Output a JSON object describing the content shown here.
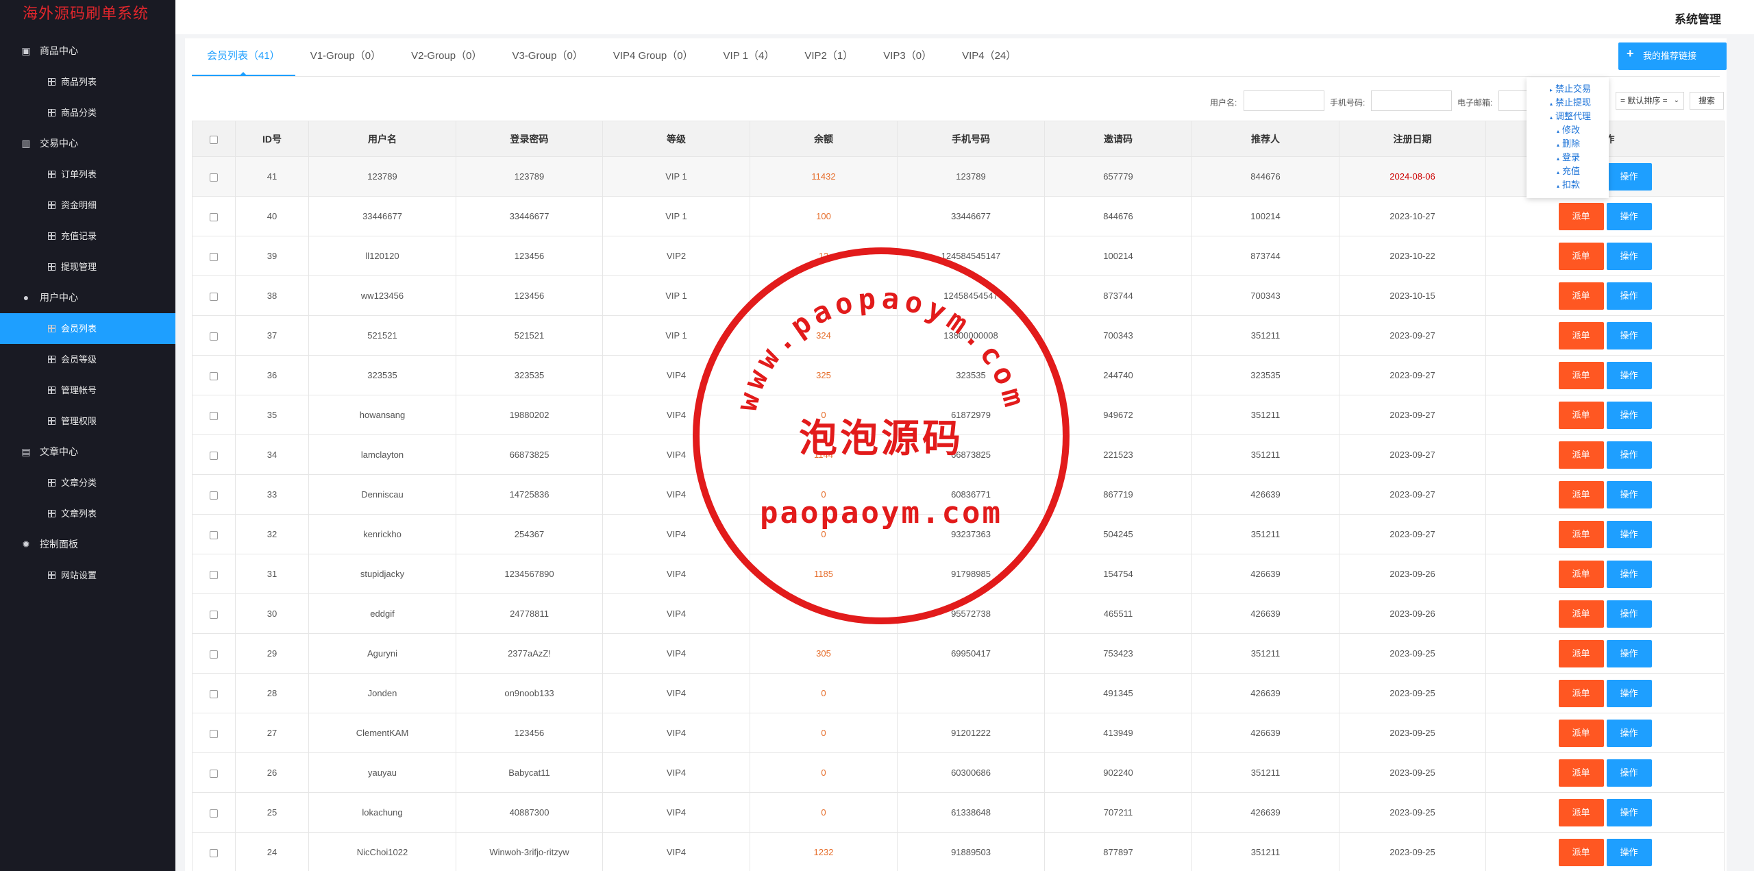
{
  "brand": "海外源码刷单系统",
  "header": {
    "title": "系统管理"
  },
  "sidebar": {
    "groups": [
      {
        "label": "商品中心",
        "icon": "product-icon",
        "items": [
          {
            "label": "商品列表"
          },
          {
            "label": "商品分类"
          }
        ]
      },
      {
        "label": "交易中心",
        "icon": "chart-icon",
        "items": [
          {
            "label": "订单列表"
          },
          {
            "label": "资金明细"
          },
          {
            "label": "充值记录"
          },
          {
            "label": "提现管理"
          }
        ]
      },
      {
        "label": "用户中心",
        "icon": "user-icon",
        "items": [
          {
            "label": "会员列表"
          },
          {
            "label": "会员等级"
          },
          {
            "label": "管理帐号"
          },
          {
            "label": "管理权限"
          }
        ]
      },
      {
        "label": "文章中心",
        "icon": "document-icon",
        "items": [
          {
            "label": "文章分类"
          },
          {
            "label": "文章列表"
          }
        ]
      },
      {
        "label": "控制面板",
        "icon": "gear-icon",
        "items": [
          {
            "label": "网站设置"
          }
        ]
      }
    ],
    "active_item": "会员列表"
  },
  "tabs": [
    {
      "label": "会员列表（41）"
    },
    {
      "label": "V1-Group（0）"
    },
    {
      "label": "V2-Group（0）"
    },
    {
      "label": "V3-Group（0）"
    },
    {
      "label": "VIP4 Group（0）"
    },
    {
      "label": "VIP 1（4）"
    },
    {
      "label": "VIP2（1）"
    },
    {
      "label": "VIP3（0）"
    },
    {
      "label": "VIP4（24）"
    }
  ],
  "recommend_button": "我的推荐链接",
  "search": {
    "username_label": "用户名:",
    "phone_label": "手机号码:",
    "email_label": "电子邮箱:",
    "sort_value": "= 默认排序 =",
    "search_button": "搜索"
  },
  "table": {
    "headers": [
      "ID号",
      "用户名",
      "登录密码",
      "等级",
      "余额",
      "手机号码",
      "邀请码",
      "推荐人",
      "注册日期",
      "操作"
    ],
    "rows": [
      {
        "id": "41",
        "user": "123789",
        "pwd": "123789",
        "level": "VIP 1",
        "balance": "11432",
        "phone": "123789",
        "invite": "657779",
        "ref": "844676",
        "date": "2024-08-06"
      },
      {
        "id": "40",
        "user": "33446677",
        "pwd": "33446677",
        "level": "VIP 1",
        "balance": "100",
        "phone": "33446677",
        "invite": "844676",
        "ref": "100214",
        "date": "2023-10-27"
      },
      {
        "id": "39",
        "user": "ll120120",
        "pwd": "123456",
        "level": "VIP2",
        "balance": "13",
        "phone": "124584545147",
        "invite": "100214",
        "ref": "873744",
        "date": "2023-10-22"
      },
      {
        "id": "38",
        "user": "ww123456",
        "pwd": "123456",
        "level": "VIP 1",
        "balance": "",
        "phone": "12458454547",
        "invite": "873744",
        "ref": "700343",
        "date": "2023-10-15"
      },
      {
        "id": "37",
        "user": "521521",
        "pwd": "521521",
        "level": "VIP 1",
        "balance": "324",
        "phone": "13800000008",
        "invite": "700343",
        "ref": "351211",
        "date": "2023-09-27"
      },
      {
        "id": "36",
        "user": "323535",
        "pwd": "323535",
        "level": "VIP4",
        "balance": "325",
        "phone": "323535",
        "invite": "244740",
        "ref": "323535",
        "date": "2023-09-27"
      },
      {
        "id": "35",
        "user": "howansang",
        "pwd": "19880202",
        "level": "VIP4",
        "balance": "0",
        "phone": "61872979",
        "invite": "949672",
        "ref": "351211",
        "date": "2023-09-27"
      },
      {
        "id": "34",
        "user": "lamclayton",
        "pwd": "66873825",
        "level": "VIP4",
        "balance": "1144",
        "phone": "66873825",
        "invite": "221523",
        "ref": "351211",
        "date": "2023-09-27"
      },
      {
        "id": "33",
        "user": "Denniscau",
        "pwd": "14725836",
        "level": "VIP4",
        "balance": "0",
        "phone": "60836771",
        "invite": "867719",
        "ref": "426639",
        "date": "2023-09-27"
      },
      {
        "id": "32",
        "user": "kenrickho",
        "pwd": "254367",
        "level": "VIP4",
        "balance": "0",
        "phone": "93237363",
        "invite": "504245",
        "ref": "351211",
        "date": "2023-09-27"
      },
      {
        "id": "31",
        "user": "stupidjacky",
        "pwd": "1234567890",
        "level": "VIP4",
        "balance": "1185",
        "phone": "91798985",
        "invite": "154754",
        "ref": "426639",
        "date": "2023-09-26"
      },
      {
        "id": "30",
        "user": "eddgif",
        "pwd": "24778811",
        "level": "VIP4",
        "balance": "",
        "phone": "95572738",
        "invite": "465511",
        "ref": "426639",
        "date": "2023-09-26"
      },
      {
        "id": "29",
        "user": "Aguryni",
        "pwd": "2377aAzZ!",
        "level": "VIP4",
        "balance": "305",
        "phone": "69950417",
        "invite": "753423",
        "ref": "351211",
        "date": "2023-09-25"
      },
      {
        "id": "28",
        "user": "Jonden",
        "pwd": "on9noob133",
        "level": "VIP4",
        "balance": "0",
        "phone": "",
        "invite": "491345",
        "ref": "426639",
        "date": "2023-09-25"
      },
      {
        "id": "27",
        "user": "ClementKAM",
        "pwd": "123456",
        "level": "VIP4",
        "balance": "0",
        "phone": "91201222",
        "invite": "413949",
        "ref": "426639",
        "date": "2023-09-25"
      },
      {
        "id": "26",
        "user": "yauyau",
        "pwd": "Babycat11",
        "level": "VIP4",
        "balance": "0",
        "phone": "60300686",
        "invite": "902240",
        "ref": "351211",
        "date": "2023-09-25"
      },
      {
        "id": "25",
        "user": "lokachung",
        "pwd": "40887300",
        "level": "VIP4",
        "balance": "0",
        "phone": "61338648",
        "invite": "707211",
        "ref": "426639",
        "date": "2023-09-25"
      },
      {
        "id": "24",
        "user": "NicChoi1022",
        "pwd": "Winwoh-3rifjo-ritzyw",
        "level": "VIP4",
        "balance": "1232",
        "phone": "91889503",
        "invite": "877897",
        "ref": "351211",
        "date": "2023-09-25"
      }
    ],
    "dispatch_label": "派单",
    "operate_label": "操作"
  },
  "dropdown": {
    "items": [
      "禁止交易",
      "禁止提现",
      "调整代理",
      "修改",
      "删除",
      "登录",
      "充值",
      "扣款"
    ]
  },
  "watermark": {
    "arc_text": "www.paopaoym.com",
    "cn_text": "泡泡源码",
    "url_text": "paopaoym.com"
  },
  "colors": {
    "sidebar_bg": "#191a23",
    "accent": "#1e9fff",
    "dispatch": "#ff5722",
    "brand": "#e0262c",
    "seal": "#e21b1b"
  }
}
